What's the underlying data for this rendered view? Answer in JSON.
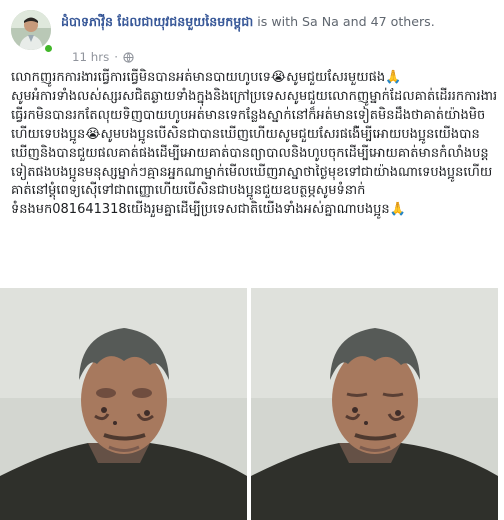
{
  "post": {
    "author": "ដំបាទភាវ៉ុិន ដែលជាយុវជនមួយនៃមកម្ពុជា",
    "with_text": "is with Sa Na and 47 others.",
    "timestamp": "11 hrs",
    "paragraph1": "លោកញូរកការងារធ្វើការធ្វើមិនបានអត់មានបាយហូបទេ😭សូមជួយសែរមួយផង🙏",
    "paragraph2": "សូមអំការទាំងលស់ស្សរសជិតឆ្ងាយទាំងក្នុងនិងក្រៅប្រទេសសូមជួយលោកញូម្នាក់ដែលគាត់ដើររកការងារធ្វើរកមិនបានរកតែលុយទិញបាយហូបអត់មានទេកន្លែងស្នាក់នៅក៏អត់មានទៀតមិនដឹងថាគាត់យ៉ាងមិចហើយទេបងប្អូន😭សូមបងប្អូនបើសិនជាបានឃើញហើយសូមជួយសែរផង់ើម្បីអោយបងប្អូនយើងបានឃើញនិងបានជួយផលគាត់ផងដើម្បីអោយគាត់បានព្យាបាលនិងហូបចុកដើម្បីអោយគាត់មានកំលាំងបន្តទៀតផងបងប្អូនមនុស្សម្នាក់ៗគ្មានអ្នកណាម្នាក់មើលឃើញរាស្នាថាថ្ងៃមុខទៅជាយ៉ាងណាទេបងប្អូនហើយគាត់នៅម្តុំពេទ្យស៊ើទៅជាពញ្ញោហើយបើសិនជាបងប្អូនជួយឧបត្ថម្ភសូមទំនាក់ទំនងមក081641318យើងរួមគ្នាដើម្បីប្រទេសជាតិយើងទាំងអស់គ្នាណាបងប្អូន🙏"
  },
  "icons": {
    "privacy": "globe-icon",
    "online": "online-status-dot"
  },
  "colors": {
    "link": "#385898",
    "meta": "#90949c",
    "online": "#42b72a"
  }
}
